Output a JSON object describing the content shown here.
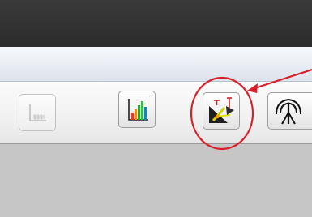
{
  "window": {
    "title_bar_color": "#2f2f2f",
    "menu_strip_color": "#e8edf4"
  },
  "toolbar": {
    "buttons": [
      {
        "name": "axis-grid",
        "icon": "axis-grid-icon",
        "enabled": false
      },
      {
        "name": "bar-chart",
        "icon": "bar-chart-icon",
        "enabled": true
      },
      {
        "name": "measure-tool",
        "icon": "measure-tool-icon",
        "enabled": true,
        "highlighted": true
      },
      {
        "name": "antenna",
        "icon": "antenna-icon",
        "enabled": true
      }
    ]
  },
  "annotation": {
    "shape": "circle-with-arrow",
    "color": "#d9202a",
    "target": "measure-tool"
  }
}
